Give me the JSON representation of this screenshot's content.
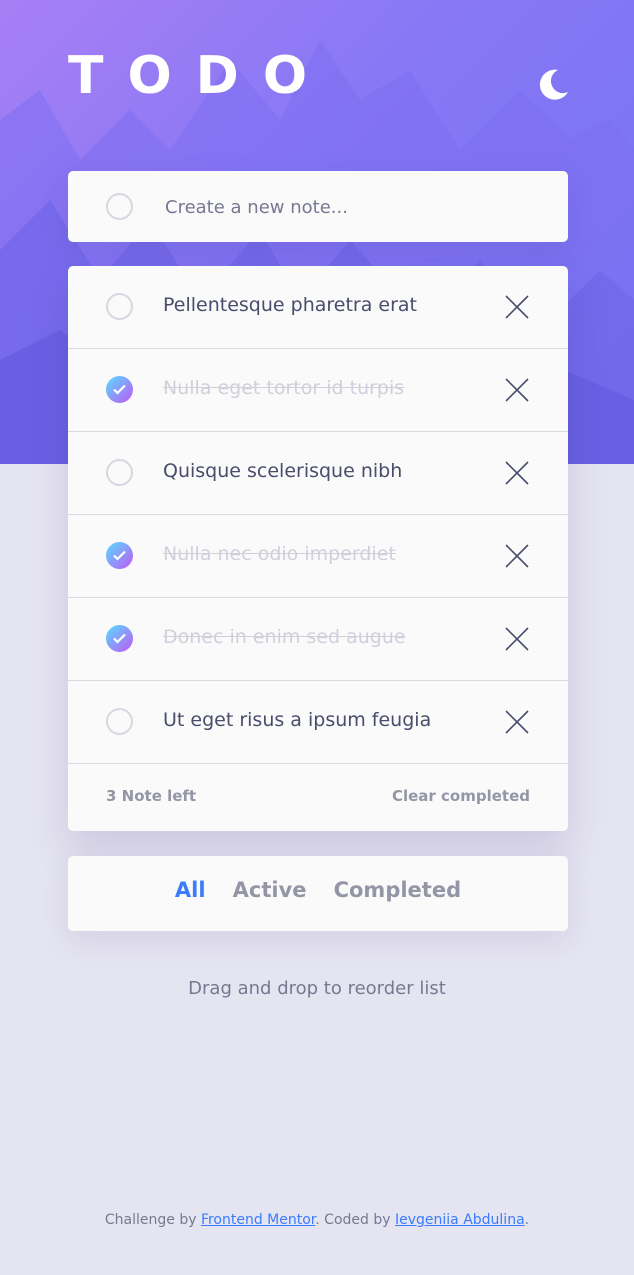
{
  "header": {
    "title": "TODO",
    "theme_icon": "moon-icon"
  },
  "create": {
    "placeholder": "Create a new note..."
  },
  "todos": [
    {
      "text": "Pellentesque pharetra erat",
      "completed": false
    },
    {
      "text": "Nulla eget tortor id turpis",
      "completed": true
    },
    {
      "text": "Quisque scelerisque nibh",
      "completed": false
    },
    {
      "text": "Nulla nec odio imperdiet",
      "completed": true
    },
    {
      "text": "Donec in enim sed augue",
      "completed": true
    },
    {
      "text": "Ut eget risus a ipsum feugia",
      "completed": false
    }
  ],
  "list_footer": {
    "items_left": "3 Note left",
    "clear_label": "Clear completed"
  },
  "filters": {
    "all": "All",
    "active": "Active",
    "completed": "Completed",
    "selected": "All"
  },
  "hint": "Drag and drop to reorder list",
  "credit": {
    "prefix": "Challenge by ",
    "mentor": "Frontend Mentor",
    "middle": ". Coded by ",
    "author": "Ievgeniia Abdulina",
    "suffix": "."
  },
  "colors": {
    "accent": "#3a7cfd",
    "check_gradient_start": "#56ddff",
    "check_gradient_end": "#c058f3",
    "page_background": "#e5e4f1",
    "card_background": "#fafafa"
  }
}
